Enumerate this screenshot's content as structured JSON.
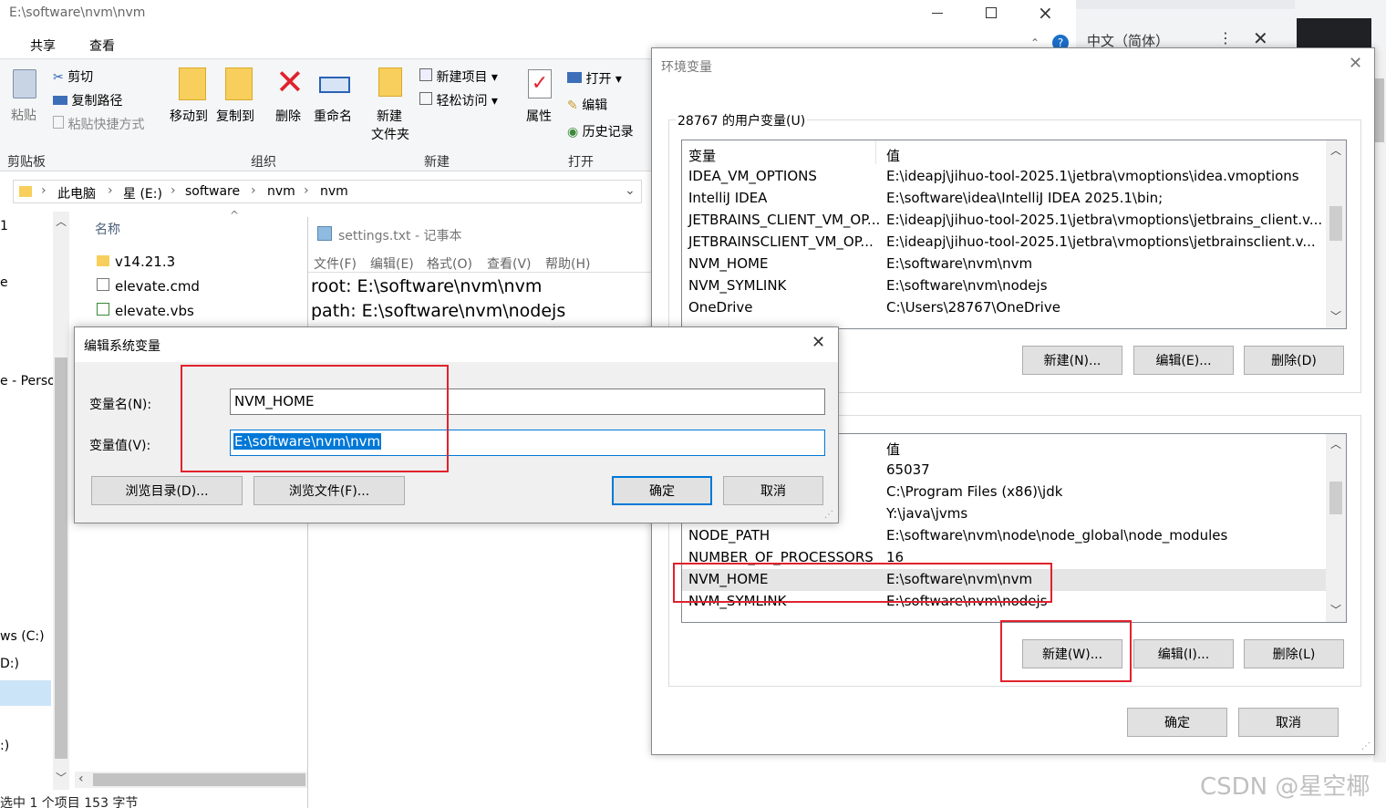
{
  "explorer": {
    "title": "E:\\software\\nvm\\nvm",
    "menu_share": "共享",
    "menu_view": "查看",
    "clipboard": {
      "paste": "粘贴",
      "cut": "剪切",
      "copy_path": "复制路径",
      "paste_shortcut": "粘贴快捷方式",
      "group": "剪贴板"
    },
    "organize": {
      "move_to": "移动到",
      "copy_to": "复制到",
      "delete": "删除",
      "rename": "重命名",
      "group": "组织"
    },
    "new": {
      "new_folder_1": "新建",
      "new_folder_2": "文件夹",
      "new_item": "新建项目",
      "easy_access": "轻松访问",
      "group": "新建"
    },
    "open": {
      "properties": "属性",
      "open": "打开",
      "edit": "编辑",
      "history": "历史记录",
      "group": "打开"
    },
    "breadcrumb": [
      "此电脑",
      "星 (E:)",
      "software",
      "nvm",
      "nvm"
    ],
    "column_name": "名称",
    "files": [
      "v14.21.3",
      "elevate.cmd",
      "elevate.vbs"
    ],
    "nav_items": [
      "1",
      "e",
      "e - Perso",
      "ws (C:)",
      "D:)",
      ":)"
    ],
    "status": "选中 1 个项目  153 字节"
  },
  "browser_fragment": {
    "language": "中文（简体）"
  },
  "notepad": {
    "title": "settings.txt - 记事本",
    "menu": [
      "文件(F)",
      "编辑(E)",
      "格式(O)",
      "查看(V)",
      "帮助(H)"
    ],
    "lines": [
      "root: E:\\software\\nvm\\nvm",
      "path: E:\\software\\nvm\\nodejs"
    ]
  },
  "env_dialog": {
    "title": "环境变量",
    "user_section": "28767 的用户变量(U)",
    "col_var": "变量",
    "col_val": "值",
    "user_vars": [
      {
        "name": "IDEA_VM_OPTIONS",
        "value": "E:\\ideapj\\jihuo-tool-2025.1\\jetbra\\vmoptions\\idea.vmoptions"
      },
      {
        "name": "IntelliJ IDEA",
        "value": "E:\\software\\idea\\IntelliJ IDEA 2025.1\\bin;"
      },
      {
        "name": "JETBRAINS_CLIENT_VM_OP...",
        "value": "E:\\ideapj\\jihuo-tool-2025.1\\jetbra\\vmoptions\\jetbrains_client.v..."
      },
      {
        "name": "JETBRAINSCLIENT_VM_OP...",
        "value": "E:\\ideapj\\jihuo-tool-2025.1\\jetbra\\vmoptions\\jetbrainsclient.v..."
      },
      {
        "name": "NVM_HOME",
        "value": "E:\\software\\nvm\\nvm"
      },
      {
        "name": "NVM_SYMLINK",
        "value": "E:\\software\\nvm\\nodejs"
      },
      {
        "name": "OneDrive",
        "value": "C:\\Users\\28767\\OneDrive"
      }
    ],
    "user_buttons": {
      "new": "新建(N)...",
      "edit": "编辑(E)...",
      "delete": "删除(D)"
    },
    "sys_vars": [
      {
        "name": "",
        "value": "65037"
      },
      {
        "name": "",
        "value": "C:\\Program Files (x86)\\jdk"
      },
      {
        "name": "",
        "value": "Y:\\java\\jvms"
      },
      {
        "name": "NODE_PATH",
        "value": "E:\\software\\nvm\\node\\node_global\\node_modules"
      },
      {
        "name": "NUMBER_OF_PROCESSORS",
        "value": "16"
      },
      {
        "name": "NVM_HOME",
        "value": "E:\\software\\nvm\\nvm"
      },
      {
        "name": "NVM_SYMLINK",
        "value": "E:\\software\\nvm\\nodejs"
      }
    ],
    "sys_buttons": {
      "new": "新建(W)...",
      "edit": "编辑(I)...",
      "delete": "删除(L)"
    },
    "ok": "确定",
    "cancel": "取消"
  },
  "edit_dialog": {
    "title": "编辑系统变量",
    "name_label": "变量名(N):",
    "name_value": "NVM_HOME",
    "value_label": "变量值(V):",
    "value_value": "E:\\software\\nvm\\nvm",
    "browse_dir": "浏览目录(D)...",
    "browse_file": "浏览文件(F)...",
    "ok": "确定",
    "cancel": "取消"
  },
  "watermark": "CSDN @星空椰",
  "colors": {
    "accent": "#0078d7",
    "highlight_red": "#e0222c",
    "selection": "#0078d7"
  }
}
